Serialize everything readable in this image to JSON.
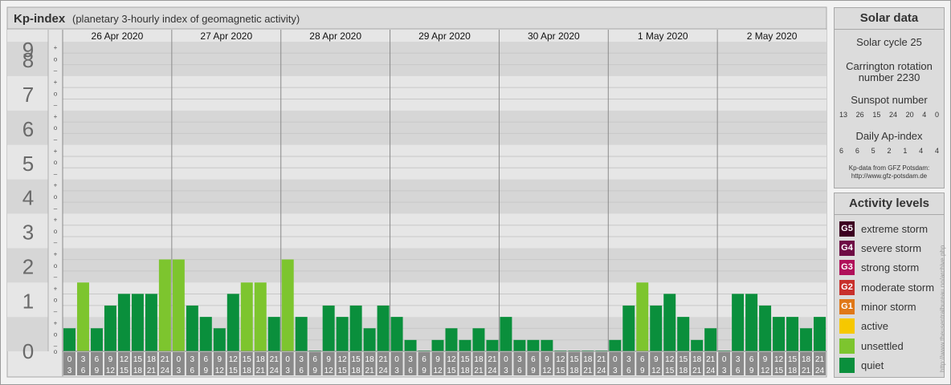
{
  "header": {
    "title": "Kp-index",
    "subtitle": "(planetary 3-hourly index of geomagnetic activity)"
  },
  "chart_data": {
    "type": "bar",
    "title": "Kp-index",
    "subtitle": "(planetary 3-hourly index of geomagnetic activity)",
    "ylim": [
      0,
      9
    ],
    "y_ticks": [
      "0",
      "1",
      "2",
      "3",
      "4",
      "5",
      "6",
      "7",
      "8",
      "9"
    ],
    "sub_ticks": [
      "+",
      "o",
      "–"
    ],
    "days": [
      "26 Apr 2020",
      "27 Apr 2020",
      "28 Apr 2020",
      "29 Apr 2020",
      "30 Apr 2020",
      "1 May 2020",
      "2 May 2020"
    ],
    "interval_start": [
      "0",
      "3",
      "6",
      "9",
      "12",
      "15",
      "18",
      "21"
    ],
    "interval_end": [
      "3",
      "6",
      "9",
      "12",
      "15",
      "18",
      "21",
      "24"
    ],
    "values": [
      [
        0.67,
        2.0,
        0.67,
        1.33,
        1.67,
        1.67,
        1.67,
        2.67
      ],
      [
        2.67,
        1.33,
        1.0,
        0.67,
        1.67,
        2.0,
        2.0,
        1.0
      ],
      [
        2.67,
        1.0,
        0.0,
        1.33,
        1.0,
        1.33,
        0.67,
        1.33
      ],
      [
        1.0,
        0.33,
        0.0,
        0.33,
        0.67,
        0.33,
        0.67,
        0.33
      ],
      [
        1.0,
        0.33,
        0.33,
        0.33,
        0.0,
        0.0,
        0.0,
        0.0
      ],
      [
        0.33,
        1.33,
        2.0,
        1.33,
        1.67,
        1.0,
        0.33,
        0.67
      ],
      [
        0.0,
        1.67,
        1.67,
        1.33,
        1.0,
        1.0,
        0.67,
        1.0
      ]
    ],
    "colors": {
      "quiet": "#0a8f3c",
      "unsettled": "#7dc52e",
      "active": "#f6c800",
      "g1": "#e07818",
      "g2": "#c8302c",
      "g3": "#b0105a",
      "g4": "#6e0c44",
      "g5": "#3c0020"
    }
  },
  "solar": {
    "title": "Solar data",
    "cycle": "Solar cycle 25",
    "carrington_line1": "Carrington rotation",
    "carrington_line2": "number 2230",
    "sunspot_label": "Sunspot number",
    "sunspot_numbers": [
      "13",
      "26",
      "15",
      "24",
      "20",
      "4",
      "0"
    ],
    "ap_label": "Daily Ap-index",
    "ap_numbers": [
      "6",
      "6",
      "5",
      "2",
      "1",
      "4",
      "4"
    ],
    "source_line1": "Kp-data from GFZ Potsdam:",
    "source_line2": "http://www.gfz-potsdam.de"
  },
  "levels": {
    "title": "Activity levels",
    "items": [
      {
        "code": "G5",
        "label": "extreme storm",
        "color": "#3c0020"
      },
      {
        "code": "G4",
        "label": "severe storm",
        "color": "#6e0c44"
      },
      {
        "code": "G3",
        "label": "strong storm",
        "color": "#b0105a"
      },
      {
        "code": "G2",
        "label": "moderate storm",
        "color": "#c8302c"
      },
      {
        "code": "G1",
        "label": "minor storm",
        "color": "#e07818"
      },
      {
        "code": "",
        "label": "active",
        "color": "#f6c800"
      },
      {
        "code": "",
        "label": "unsettled",
        "color": "#7dc52e"
      },
      {
        "code": "",
        "label": "quiet",
        "color": "#0a8f3c"
      }
    ]
  },
  "watermark": "http://www.theusentralbureau.no/archive.php"
}
